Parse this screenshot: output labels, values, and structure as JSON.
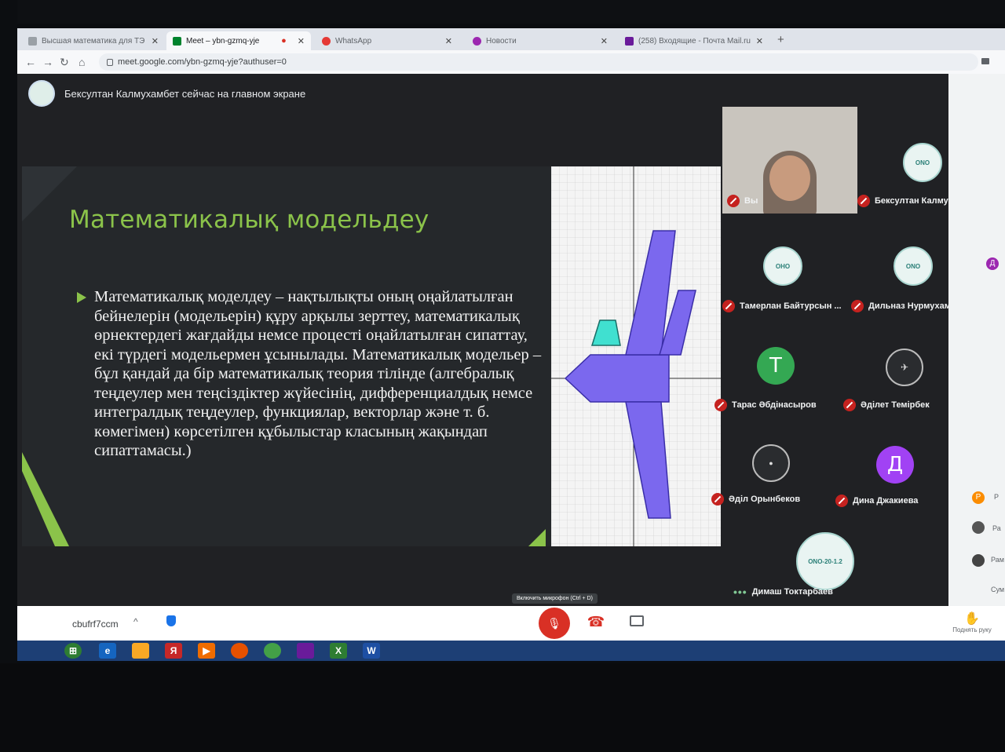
{
  "browser": {
    "tabs": [
      {
        "label": "Высшая математика для ТЭ",
        "favicon": "#9aa0a6"
      },
      {
        "label": "Meet – ybn-gzmq-yje",
        "favicon": "#00832d"
      },
      {
        "label": "WhatsApp",
        "favicon": "#e53935"
      },
      {
        "label": "Новости",
        "favicon": "#9c27b0"
      },
      {
        "label": "(258) Входящие - Почта Mail.ru",
        "favicon": "#6a1b9a"
      }
    ],
    "url": "meet.google.com/ybn-gzmq-yje?authuser=0"
  },
  "meet": {
    "presenting_banner": "Бексултан Калмухамбет сейчас на главном экране",
    "slide": {
      "title": "Математикалық модельдеу",
      "body": "Математикалық моделдеу – нақтылықты оның оңайлатылған бейнелерін (модельерін) құру арқылы зерттеу, математикалық өрнектердегі жағдайды немсе процесті оңайлатылған сипаттау, екі түрдегі модельермен ұсынылады. Математикалық модельер – бұл қандай да бір математикалық теория тілінде (алгебралық теңдеулер мен теңсіздіктер жүйесінің, дифференциалдық немсе интегралдық теңдеулер, функциялар, векторлар және т. б. көмегімен) көрсетілген құбылыстар класының жақындап сипаттамасы.)"
    },
    "participants": [
      {
        "name": "Вы",
        "muted": true
      },
      {
        "name": "Бексултан Калмухамб...",
        "muted": true
      },
      {
        "name": "Тамерлан Байтурсын ...",
        "muted": true
      },
      {
        "name": "Дильназ Нурмухамбет",
        "muted": true
      },
      {
        "name": "Тарас Әбдінасыров",
        "muted": true,
        "initial": "Т",
        "color": "#34a853"
      },
      {
        "name": "Әділет Темірбек",
        "muted": true
      },
      {
        "name": "Әділ Орынбеков",
        "muted": true
      },
      {
        "name": "Дина Джакиева",
        "muted": true,
        "initial": "Д",
        "color": "#a142f4"
      },
      {
        "name": "Димаш Токтарбаев",
        "muted": false
      }
    ],
    "side_strip": {
      "initials": [
        "Д",
        "Р"
      ],
      "labels": [
        "Р",
        "Ра",
        "Рам",
        "Сум"
      ]
    },
    "bottom_bar": {
      "meeting_code": "cbufrf7ccm",
      "mic_tooltip": "Включить микрофон (Ctrl + D)",
      "raise_hand_label": "Поднять руку"
    }
  },
  "taskbar": {
    "apps": [
      "start",
      "ie",
      "folder",
      "yandex",
      "media",
      "firefox",
      "chrome",
      "winrar",
      "excel",
      "word"
    ]
  }
}
